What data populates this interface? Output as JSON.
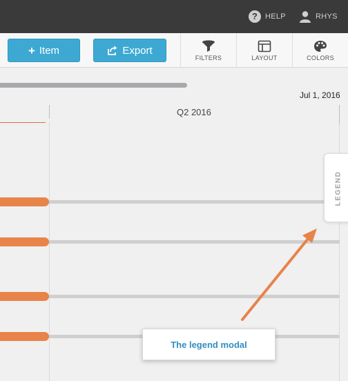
{
  "topbar": {
    "help_label": "HELP",
    "user_label": "RHYS"
  },
  "toolbar": {
    "item_button": {
      "label": "Item",
      "icon": "plus-icon"
    },
    "export_button": {
      "label": "Export",
      "icon": "export-icon"
    },
    "tools": [
      {
        "label": "FILTERS",
        "icon": "funnel-icon"
      },
      {
        "label": "LAYOUT",
        "icon": "layout-icon"
      },
      {
        "label": "COLORS",
        "icon": "palette-icon"
      }
    ],
    "button_color": "#3da9d3"
  },
  "timeline": {
    "date_marker": "Jul 1, 2016",
    "quarter_label": "Q2 2016",
    "bar_color": "#e8834a",
    "track_color": "#cfcfcf"
  },
  "legend_tab": {
    "label": "LEGEND"
  },
  "callout": {
    "text": "The legend modal",
    "arrow_color": "#e8834a"
  }
}
